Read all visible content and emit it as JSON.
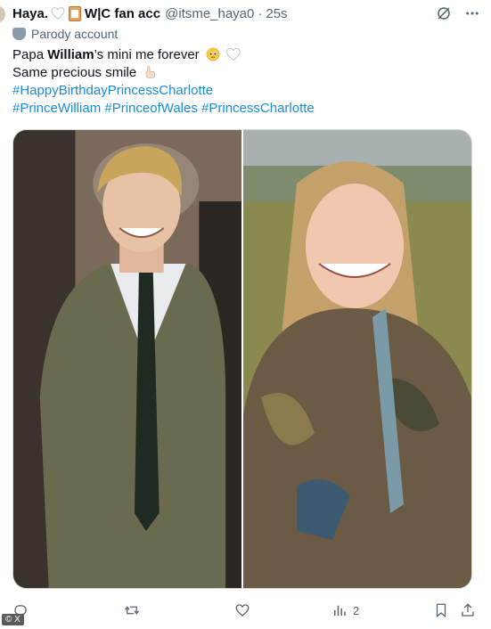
{
  "header": {
    "display_name": "Haya.",
    "display_name_suffix": "W|C fan acc",
    "handle": "@itsme_haya0",
    "separator": "·",
    "time": "25s",
    "icons": [
      "white-heart-icon",
      "clipboard-icon",
      "grok-icon",
      "more-icon"
    ]
  },
  "parody_label": "Parody account",
  "body": {
    "line1_prefix": "Papa ",
    "line1_bold": "William",
    "line1_suffix": "’s mini me forever",
    "line2": "Same precious smile",
    "hashtags_line1": "#HappyBirthdayPrincessCharlotte",
    "hashtags_line2": [
      "#PrinceWilliam",
      "#PrinceofWales",
      "#PrincessCharlotte"
    ]
  },
  "media": {
    "left_photo": "young-boy-in-suit-smiling",
    "right_photo": "young-girl-in-camo-jacket-smiling"
  },
  "actions": {
    "reply_count": "",
    "retweet_count": "",
    "like_count": "",
    "views_count": "2"
  },
  "watermark": "© X"
}
